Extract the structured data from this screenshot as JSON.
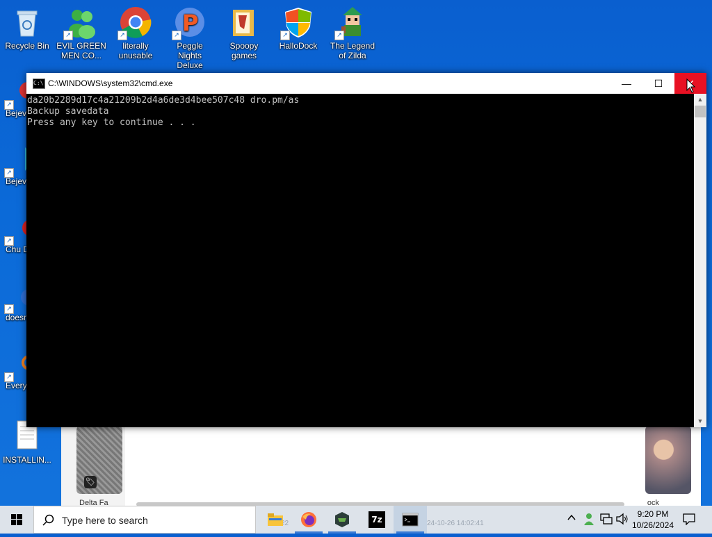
{
  "desktop": {
    "icons": [
      {
        "label": "Recycle Bin",
        "icon": "recycle-bin-icon"
      },
      {
        "label": "EVIL GREEN MEN CO...",
        "icon": "green-men-icon"
      },
      {
        "label": "literally unusable",
        "icon": "chrome-icon"
      },
      {
        "label": "Peggle Nights Deluxe",
        "icon": "peggle-icon"
      },
      {
        "label": "Spoopy games",
        "icon": "folder-icon"
      },
      {
        "label": "HalloDock",
        "icon": "windows-shield-icon"
      },
      {
        "label": "The Legend of Zilda",
        "icon": "zelda-icon"
      }
    ],
    "left_icons": [
      {
        "label": "Bejev Delu",
        "icon": "bejeweled-icon"
      },
      {
        "label": "Bejev Delu",
        "icon": "bejeweled-icon"
      },
      {
        "label": "Chu Delu",
        "icon": "chuzzle-icon"
      },
      {
        "label": "doesn",
        "icon": "app-icon"
      },
      {
        "label": "Every",
        "icon": "everything-icon"
      },
      {
        "label": "INSTALLIN...",
        "icon": "text-file-icon"
      }
    ]
  },
  "background_window": {
    "caption_left": "Delta Fa",
    "caption_right": "ock"
  },
  "cmd": {
    "title": "C:\\WINDOWS\\system32\\cmd.exe",
    "lines": [
      "da20b2289d17c4a21209b2d4a6de3d4bee507c48 dro.pm/as",
      "Backup savedata",
      "Press any key to continue . . ."
    ],
    "minimize_glyph": "—",
    "maximize_glyph": "☐",
    "close_glyph": "✕"
  },
  "taskbar": {
    "search_placeholder": "Type here to search",
    "apps": [
      {
        "name": "file-explorer-icon"
      },
      {
        "name": "firefox-icon"
      },
      {
        "name": "app-hex-icon"
      },
      {
        "name": "7zip-icon",
        "label": "7z"
      },
      {
        "name": "cmd-icon"
      }
    ],
    "faded_text_1": "22",
    "faded_text_2": "24-10-26 14:02:41",
    "time": "9:20 PM",
    "date": "10/26/2024"
  }
}
